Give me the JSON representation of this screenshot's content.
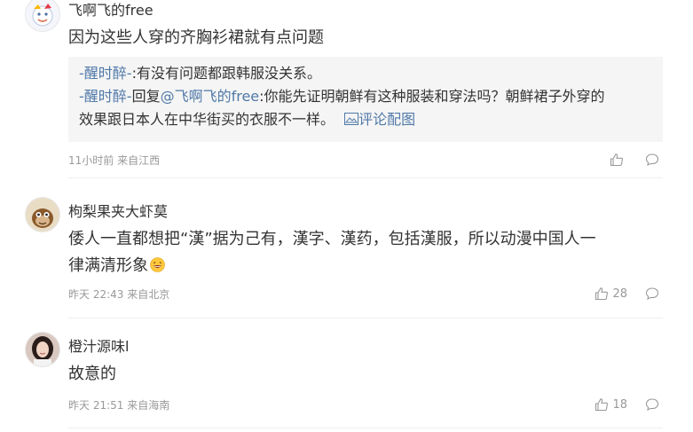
{
  "comments": [
    {
      "username": "飞啊飞的free",
      "text": "因为这些人穿的齐胸衫裙就有点问题",
      "replies": [
        {
          "user": "-醒时醉-",
          "sep": ":",
          "text": "有没有问题都跟韩服没关系。"
        },
        {
          "user": "-醒时醉-",
          "reply_word": "回复",
          "mention": "@飞啊飞的free",
          "sep": ":",
          "text_line1": "你能先证明朝鲜有这种服装和穿法吗？朝鲜裙子外穿的",
          "text_line2": "效果跟日本人在中华街买的衣服不一样。",
          "pic_label": "评论配图"
        }
      ],
      "meta": "11小时前 来自江西",
      "likes": ""
    },
    {
      "username": "枸梨果夹大虾莫",
      "text_line1": "倭人一直都想把“漢”据为己有，漢字、漢药，包括漢服，所以动漫中国人一",
      "text_line2": "律满清形象",
      "meta": "昨天 22:43 来自北京",
      "likes": "28"
    },
    {
      "username": "橙汁源味l",
      "text": "故意的",
      "meta": "昨天 21:51 来自海南",
      "likes": "18"
    }
  ]
}
